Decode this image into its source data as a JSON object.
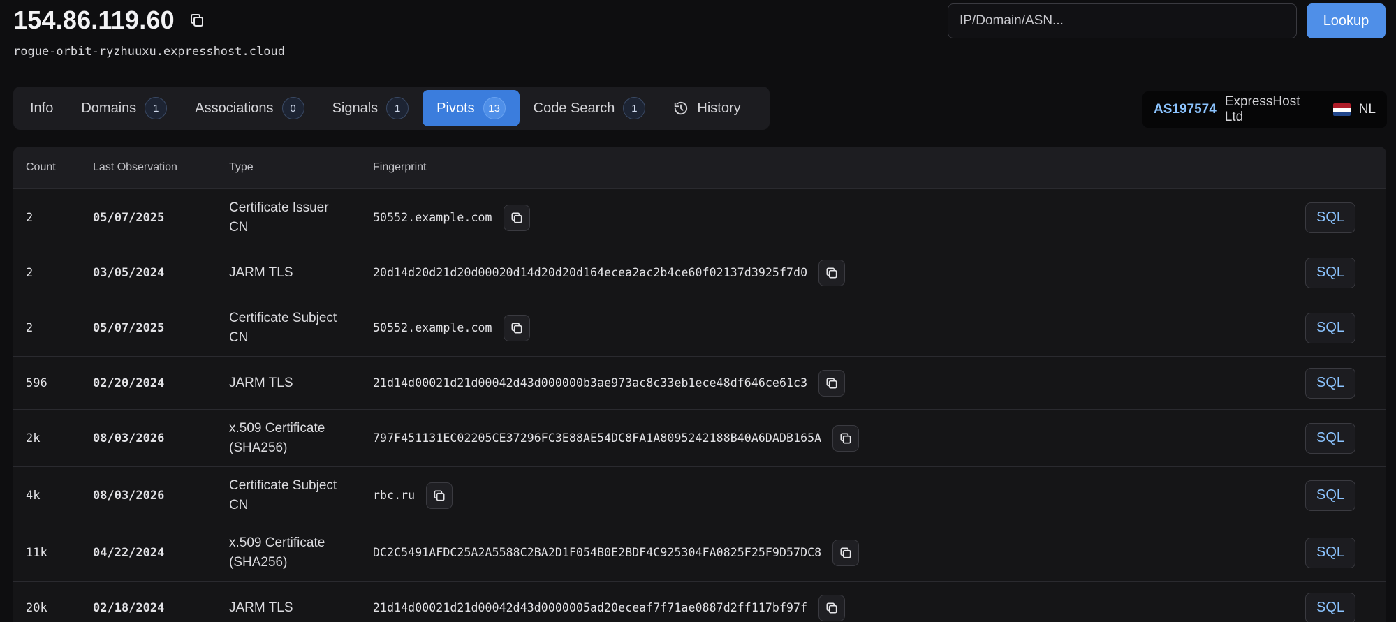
{
  "header": {
    "ip": "154.86.119.60",
    "hostname": "rogue-orbit-ryzhuuxu.expresshost.cloud"
  },
  "search": {
    "placeholder": "IP/Domain/ASN...",
    "value": "",
    "button_label": "Lookup"
  },
  "tabs": [
    {
      "label": "Info",
      "count": null
    },
    {
      "label": "Domains",
      "count": "1"
    },
    {
      "label": "Associations",
      "count": "0"
    },
    {
      "label": "Signals",
      "count": "1"
    },
    {
      "label": "Pivots",
      "count": "13",
      "active": true
    },
    {
      "label": "Code Search",
      "count": "1"
    },
    {
      "label": "History",
      "count": null,
      "icon": "history-icon"
    }
  ],
  "asn": {
    "number": "AS197574",
    "org": "ExpressHost Ltd",
    "country": "NL",
    "flag_colors": [
      "#ae1c28",
      "#ffffff",
      "#21468b"
    ]
  },
  "table": {
    "headers": [
      "Count",
      "Last Observation",
      "Type",
      "Fingerprint"
    ],
    "sql_label": "SQL",
    "rows": [
      {
        "count": "2",
        "date": "05/07/2025",
        "type": [
          "Certificate Issuer",
          "CN"
        ],
        "fingerprint": "50552.example.com"
      },
      {
        "count": "2",
        "date": "03/05/2024",
        "type": [
          "JARM TLS"
        ],
        "fingerprint": "20d14d20d21d20d00020d14d20d20d164ecea2ac2b4ce60f02137d3925f7d0"
      },
      {
        "count": "2",
        "date": "05/07/2025",
        "type": [
          "Certificate Subject",
          "CN"
        ],
        "fingerprint": "50552.example.com"
      },
      {
        "count": "596",
        "date": "02/20/2024",
        "type": [
          "JARM TLS"
        ],
        "fingerprint": "21d14d00021d21d00042d43d000000b3ae973ac8c33eb1ece48df646ce61c3"
      },
      {
        "count": "2k",
        "date": "08/03/2026",
        "type": [
          "x.509 Certificate",
          "(SHA256)"
        ],
        "fingerprint": "797F451131EC02205CE37296FC3E88AE54DC8FA1A8095242188B40A6DADB165A"
      },
      {
        "count": "4k",
        "date": "08/03/2026",
        "type": [
          "Certificate Subject",
          "CN"
        ],
        "fingerprint": "rbc.ru"
      },
      {
        "count": "11k",
        "date": "04/22/2024",
        "type": [
          "x.509 Certificate",
          "(SHA256)"
        ],
        "fingerprint": "DC2C5491AFDC25A2A5588C2BA2D1F054B0E2BDF4C925304FA0825F25F9D57DC8"
      },
      {
        "count": "20k",
        "date": "02/18/2024",
        "type": [
          "JARM TLS"
        ],
        "fingerprint": "21d14d00021d21d00042d43d0000005ad20eceaf7f71ae0887d2ff117bf97f"
      }
    ]
  },
  "icons": {
    "copy": "copy-icon",
    "history": "history-icon"
  }
}
